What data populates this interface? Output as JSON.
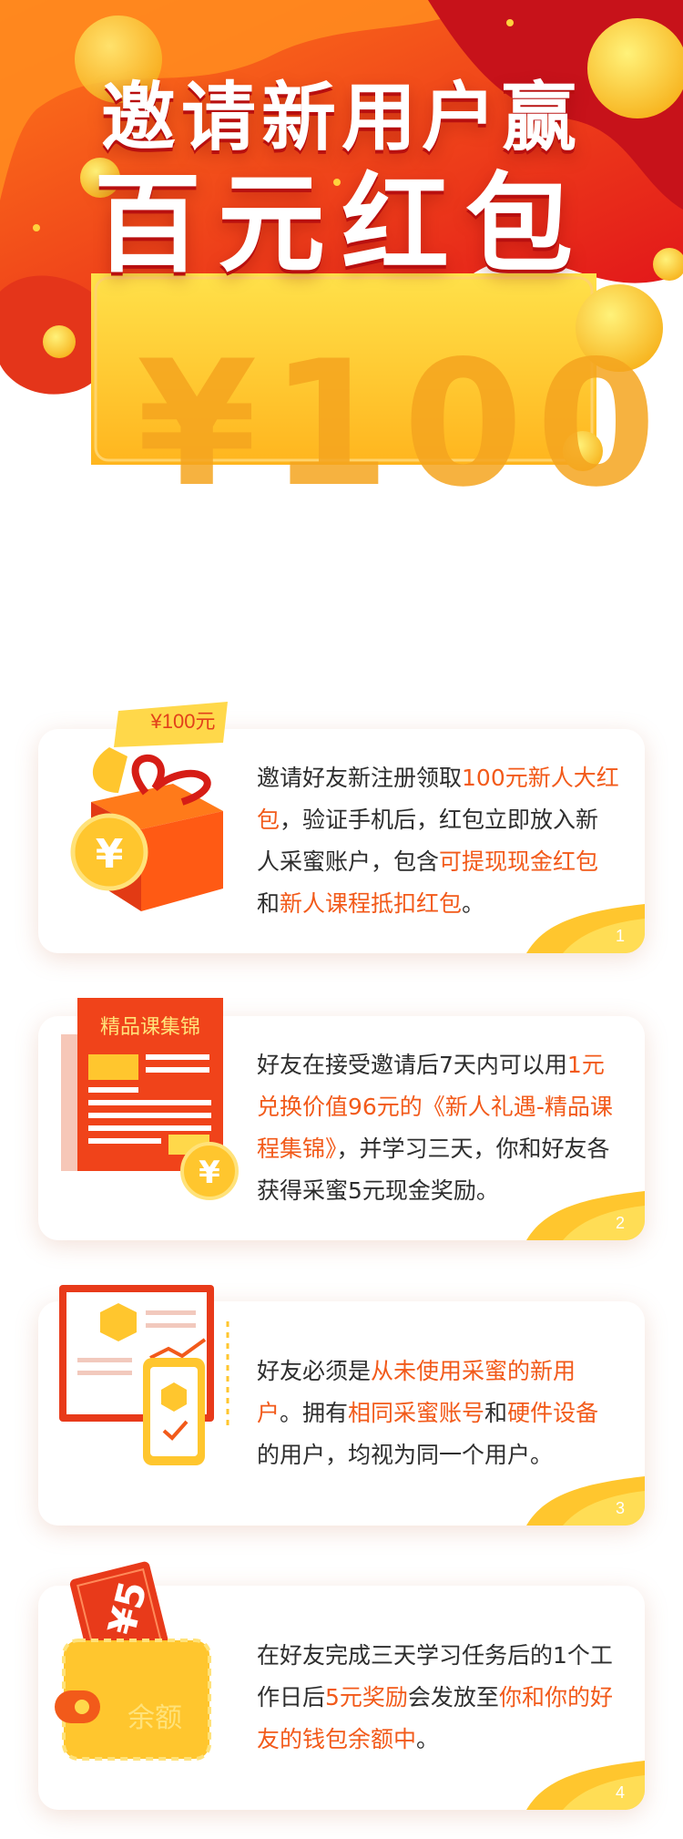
{
  "hero": {
    "title_line1": "邀请新用户赢",
    "title_line2": "百元红包",
    "ticket_amount": "¥100"
  },
  "steps": [
    {
      "tag": "¥100元",
      "segments": [
        {
          "t": "邀请好友新注册领取",
          "hl": false
        },
        {
          "t": "100元新人大红包",
          "hl": true
        },
        {
          "t": "，验证手机后，红包立即放入新人采蜜账户，包含",
          "hl": false
        },
        {
          "t": "可提现现金红包",
          "hl": true
        },
        {
          "t": "和",
          "hl": false
        },
        {
          "t": "新人课程抵扣红包",
          "hl": true
        },
        {
          "t": "。",
          "hl": false
        }
      ],
      "number": "1"
    },
    {
      "tag": "精品课集锦",
      "segments": [
        {
          "t": "好友在接受邀请后7天内可以用",
          "hl": false
        },
        {
          "t": "1元兑换价值96元的《新人礼遇-精品课程集锦》",
          "hl": true
        },
        {
          "t": "，并学习三天，你和好友各获得采蜜5元现金奖励。",
          "hl": false
        }
      ],
      "number": "2"
    },
    {
      "segments": [
        {
          "t": "好友必须是",
          "hl": false
        },
        {
          "t": "从未使用采蜜的新用户",
          "hl": true
        },
        {
          "t": "。拥有",
          "hl": false
        },
        {
          "t": "相同采蜜账号",
          "hl": true
        },
        {
          "t": "和",
          "hl": false
        },
        {
          "t": "硬件设备",
          "hl": true
        },
        {
          "t": "的用户，均视为同一个用户。",
          "hl": false
        }
      ],
      "number": "3"
    },
    {
      "tag": "¥5",
      "wallet_label": "余额",
      "segments": [
        {
          "t": "在好友完成三天学习任务后的1个工作日后",
          "hl": false
        },
        {
          "t": "5元奖励",
          "hl": true
        },
        {
          "t": "会发放至",
          "hl": false
        },
        {
          "t": "你和你的好友的钱包余额中",
          "hl": true
        },
        {
          "t": "。",
          "hl": false
        }
      ],
      "number": "4"
    }
  ],
  "colors": {
    "accent": "#f25a1a",
    "brand_red": "#e8271a",
    "gold": "#ffc62e"
  }
}
